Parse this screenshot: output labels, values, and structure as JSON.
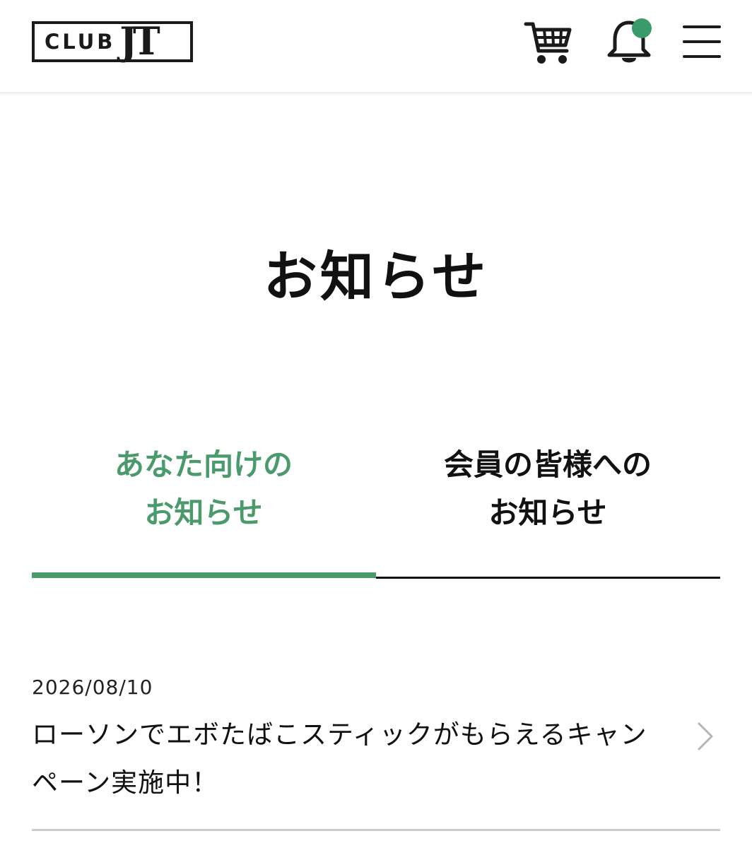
{
  "header": {
    "logo": {
      "club": "CLUB",
      "jt": "JT"
    },
    "icons": [
      "cart-icon",
      "bell-icon",
      "hamburger-menu-icon"
    ],
    "notification_dot_color": "#3a9b6a"
  },
  "page": {
    "title": "お知らせ"
  },
  "tabs": [
    {
      "label": "あなた向けの\nお知らせ",
      "active": true
    },
    {
      "label": "会員の皆様への\nお知らせ",
      "active": false
    }
  ],
  "news": [
    {
      "date": "2026/08/10",
      "title": "ローソンでエボたばこスティックがもらえるキャンペーン実施中！"
    }
  ],
  "colors": {
    "accent": "#4a9a6c",
    "text": "#111111",
    "divider": "#cccccc"
  }
}
